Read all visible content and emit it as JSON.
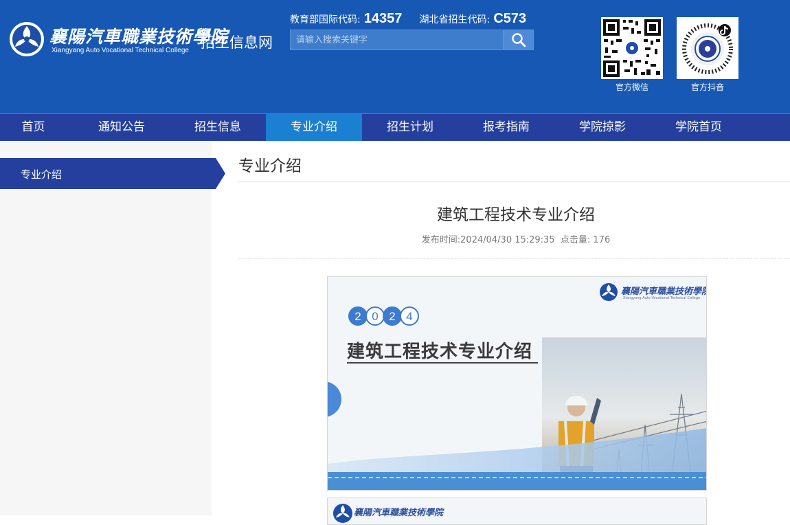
{
  "header": {
    "logo_cn": "襄陽汽車職業技術學院",
    "logo_en": "Xiangyang Auto Vocational Technical College",
    "site_name": "招生信息网",
    "moe_code_label": "教育部国际代码:",
    "moe_code_value": "14357",
    "hubei_code_label": "湖北省招生代码:",
    "hubei_code_value": "C573",
    "search_placeholder": "请输入搜索关键字",
    "qr_wechat_label": "官方微信",
    "qr_douyin_label": "官方抖音",
    "brand_color": "#1758b5"
  },
  "nav": {
    "items": [
      {
        "label": "首页"
      },
      {
        "label": "通知公告"
      },
      {
        "label": "招生信息"
      },
      {
        "label": "专业介绍"
      },
      {
        "label": "招生计划"
      },
      {
        "label": "报考指南"
      },
      {
        "label": "学院掠影"
      },
      {
        "label": "学院首页"
      }
    ],
    "active": "专业介绍",
    "bar_color": "#243f9d",
    "active_color": "#1b7fd2"
  },
  "sidebar": {
    "items": [
      {
        "label": "专业介绍"
      }
    ]
  },
  "main": {
    "heading": "专业介绍",
    "article_title": "建筑工程技术专业介绍",
    "meta_time_label": "发布时间:",
    "meta_time_value": "2024/04/30 15:29:35",
    "meta_clicks_label": "点击量:",
    "meta_clicks_value": "176",
    "slide": {
      "year_digits": [
        "2",
        "0",
        "2",
        "4"
      ],
      "title": "建筑工程技术专业介绍",
      "logo_cn": "襄陽汽車職業技術學院",
      "logo_en": "Xiangyang Auto Vocational Technical College"
    },
    "slide2": {
      "logo_cn": "襄陽汽車職業技術學院"
    }
  }
}
